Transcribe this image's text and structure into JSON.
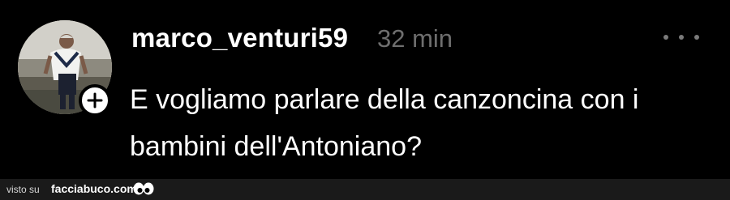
{
  "post": {
    "username": "marco_venturi59",
    "timestamp": "32 min",
    "text": "E vogliamo parlare della canzoncina con i bambini dell'Antoniano?",
    "avatar_icon": "person-photo-icon",
    "follow_icon": "plus-icon",
    "more_icon": "more-dots-icon"
  },
  "watermark": {
    "prefix": "visto su",
    "site": "facciabuco.com",
    "logo_icon": "eyes-logo-icon"
  },
  "colors": {
    "background": "#000000",
    "text": "#ffffff",
    "timestamp": "#6e6e6e",
    "watermark_bar": "#1a1a1a"
  }
}
